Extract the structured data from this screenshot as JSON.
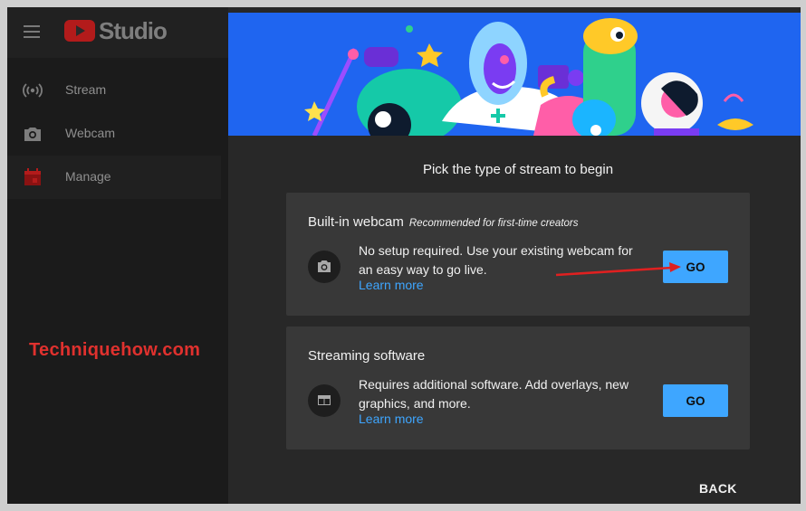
{
  "app": {
    "logo_text": "Studio"
  },
  "sidebar": {
    "items": [
      {
        "label": "Stream",
        "icon": "broadcast-icon"
      },
      {
        "label": "Webcam",
        "icon": "camera-icon"
      },
      {
        "label": "Manage",
        "icon": "calendar-icon",
        "active": true
      }
    ]
  },
  "watermark": "Techniquehow.com",
  "dialog": {
    "heading": "Pick the type of stream to begin",
    "options": [
      {
        "title": "Built-in webcam",
        "recommended": "Recommended for first-time creators",
        "description": "No setup required. Use your existing webcam for an easy way to go live.",
        "link": "Learn more",
        "button": "GO",
        "icon": "camera-icon"
      },
      {
        "title": "Streaming software",
        "description": "Requires additional software. Add overlays, new graphics, and more.",
        "link": "Learn more",
        "button": "GO",
        "icon": "window-layout-icon"
      }
    ],
    "back": "BACK"
  },
  "colors": {
    "accent": "#3ea6ff",
    "banner": "#1f65f0",
    "annotation_arrow": "#e02020",
    "watermark": "#e0312e"
  }
}
